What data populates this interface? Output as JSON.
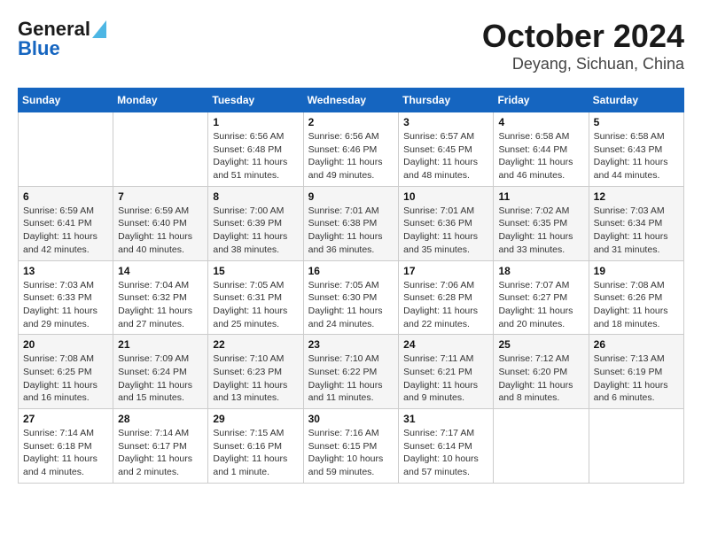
{
  "logo": {
    "text_general": "General",
    "text_blue": "Blue"
  },
  "title": "October 2024",
  "subtitle": "Deyang, Sichuan, China",
  "weekdays": [
    "Sunday",
    "Monday",
    "Tuesday",
    "Wednesday",
    "Thursday",
    "Friday",
    "Saturday"
  ],
  "weeks": [
    [
      {
        "day": "",
        "info": ""
      },
      {
        "day": "",
        "info": ""
      },
      {
        "day": "1",
        "info": "Sunrise: 6:56 AM\nSunset: 6:48 PM\nDaylight: 11 hours and 51 minutes."
      },
      {
        "day": "2",
        "info": "Sunrise: 6:56 AM\nSunset: 6:46 PM\nDaylight: 11 hours and 49 minutes."
      },
      {
        "day": "3",
        "info": "Sunrise: 6:57 AM\nSunset: 6:45 PM\nDaylight: 11 hours and 48 minutes."
      },
      {
        "day": "4",
        "info": "Sunrise: 6:58 AM\nSunset: 6:44 PM\nDaylight: 11 hours and 46 minutes."
      },
      {
        "day": "5",
        "info": "Sunrise: 6:58 AM\nSunset: 6:43 PM\nDaylight: 11 hours and 44 minutes."
      }
    ],
    [
      {
        "day": "6",
        "info": "Sunrise: 6:59 AM\nSunset: 6:41 PM\nDaylight: 11 hours and 42 minutes."
      },
      {
        "day": "7",
        "info": "Sunrise: 6:59 AM\nSunset: 6:40 PM\nDaylight: 11 hours and 40 minutes."
      },
      {
        "day": "8",
        "info": "Sunrise: 7:00 AM\nSunset: 6:39 PM\nDaylight: 11 hours and 38 minutes."
      },
      {
        "day": "9",
        "info": "Sunrise: 7:01 AM\nSunset: 6:38 PM\nDaylight: 11 hours and 36 minutes."
      },
      {
        "day": "10",
        "info": "Sunrise: 7:01 AM\nSunset: 6:36 PM\nDaylight: 11 hours and 35 minutes."
      },
      {
        "day": "11",
        "info": "Sunrise: 7:02 AM\nSunset: 6:35 PM\nDaylight: 11 hours and 33 minutes."
      },
      {
        "day": "12",
        "info": "Sunrise: 7:03 AM\nSunset: 6:34 PM\nDaylight: 11 hours and 31 minutes."
      }
    ],
    [
      {
        "day": "13",
        "info": "Sunrise: 7:03 AM\nSunset: 6:33 PM\nDaylight: 11 hours and 29 minutes."
      },
      {
        "day": "14",
        "info": "Sunrise: 7:04 AM\nSunset: 6:32 PM\nDaylight: 11 hours and 27 minutes."
      },
      {
        "day": "15",
        "info": "Sunrise: 7:05 AM\nSunset: 6:31 PM\nDaylight: 11 hours and 25 minutes."
      },
      {
        "day": "16",
        "info": "Sunrise: 7:05 AM\nSunset: 6:30 PM\nDaylight: 11 hours and 24 minutes."
      },
      {
        "day": "17",
        "info": "Sunrise: 7:06 AM\nSunset: 6:28 PM\nDaylight: 11 hours and 22 minutes."
      },
      {
        "day": "18",
        "info": "Sunrise: 7:07 AM\nSunset: 6:27 PM\nDaylight: 11 hours and 20 minutes."
      },
      {
        "day": "19",
        "info": "Sunrise: 7:08 AM\nSunset: 6:26 PM\nDaylight: 11 hours and 18 minutes."
      }
    ],
    [
      {
        "day": "20",
        "info": "Sunrise: 7:08 AM\nSunset: 6:25 PM\nDaylight: 11 hours and 16 minutes."
      },
      {
        "day": "21",
        "info": "Sunrise: 7:09 AM\nSunset: 6:24 PM\nDaylight: 11 hours and 15 minutes."
      },
      {
        "day": "22",
        "info": "Sunrise: 7:10 AM\nSunset: 6:23 PM\nDaylight: 11 hours and 13 minutes."
      },
      {
        "day": "23",
        "info": "Sunrise: 7:10 AM\nSunset: 6:22 PM\nDaylight: 11 hours and 11 minutes."
      },
      {
        "day": "24",
        "info": "Sunrise: 7:11 AM\nSunset: 6:21 PM\nDaylight: 11 hours and 9 minutes."
      },
      {
        "day": "25",
        "info": "Sunrise: 7:12 AM\nSunset: 6:20 PM\nDaylight: 11 hours and 8 minutes."
      },
      {
        "day": "26",
        "info": "Sunrise: 7:13 AM\nSunset: 6:19 PM\nDaylight: 11 hours and 6 minutes."
      }
    ],
    [
      {
        "day": "27",
        "info": "Sunrise: 7:14 AM\nSunset: 6:18 PM\nDaylight: 11 hours and 4 minutes."
      },
      {
        "day": "28",
        "info": "Sunrise: 7:14 AM\nSunset: 6:17 PM\nDaylight: 11 hours and 2 minutes."
      },
      {
        "day": "29",
        "info": "Sunrise: 7:15 AM\nSunset: 6:16 PM\nDaylight: 11 hours and 1 minute."
      },
      {
        "day": "30",
        "info": "Sunrise: 7:16 AM\nSunset: 6:15 PM\nDaylight: 10 hours and 59 minutes."
      },
      {
        "day": "31",
        "info": "Sunrise: 7:17 AM\nSunset: 6:14 PM\nDaylight: 10 hours and 57 minutes."
      },
      {
        "day": "",
        "info": ""
      },
      {
        "day": "",
        "info": ""
      }
    ]
  ]
}
